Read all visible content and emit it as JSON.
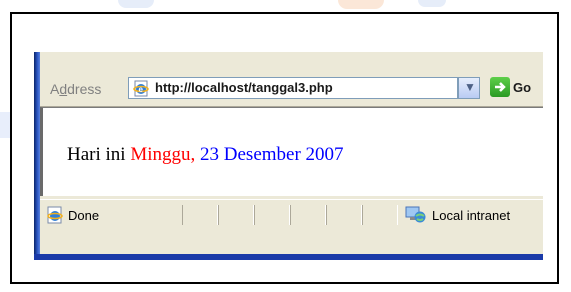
{
  "address_bar": {
    "label": "Address",
    "url": "http://localhost/tanggal3.php",
    "go_label": "Go"
  },
  "content": {
    "prefix": "Hari ini ",
    "day": "Minggu,",
    "date": " 23 Desember 2007"
  },
  "status_bar": {
    "status_text": "Done",
    "zone_text": "Local intranet"
  },
  "colors": {
    "day_color": "#ff0000",
    "date_color": "#0000ff"
  },
  "icons": [
    "ie-page-icon",
    "dropdown-arrow-icon",
    "go-arrow-icon",
    "ie-done-icon",
    "local-intranet-icon"
  ]
}
